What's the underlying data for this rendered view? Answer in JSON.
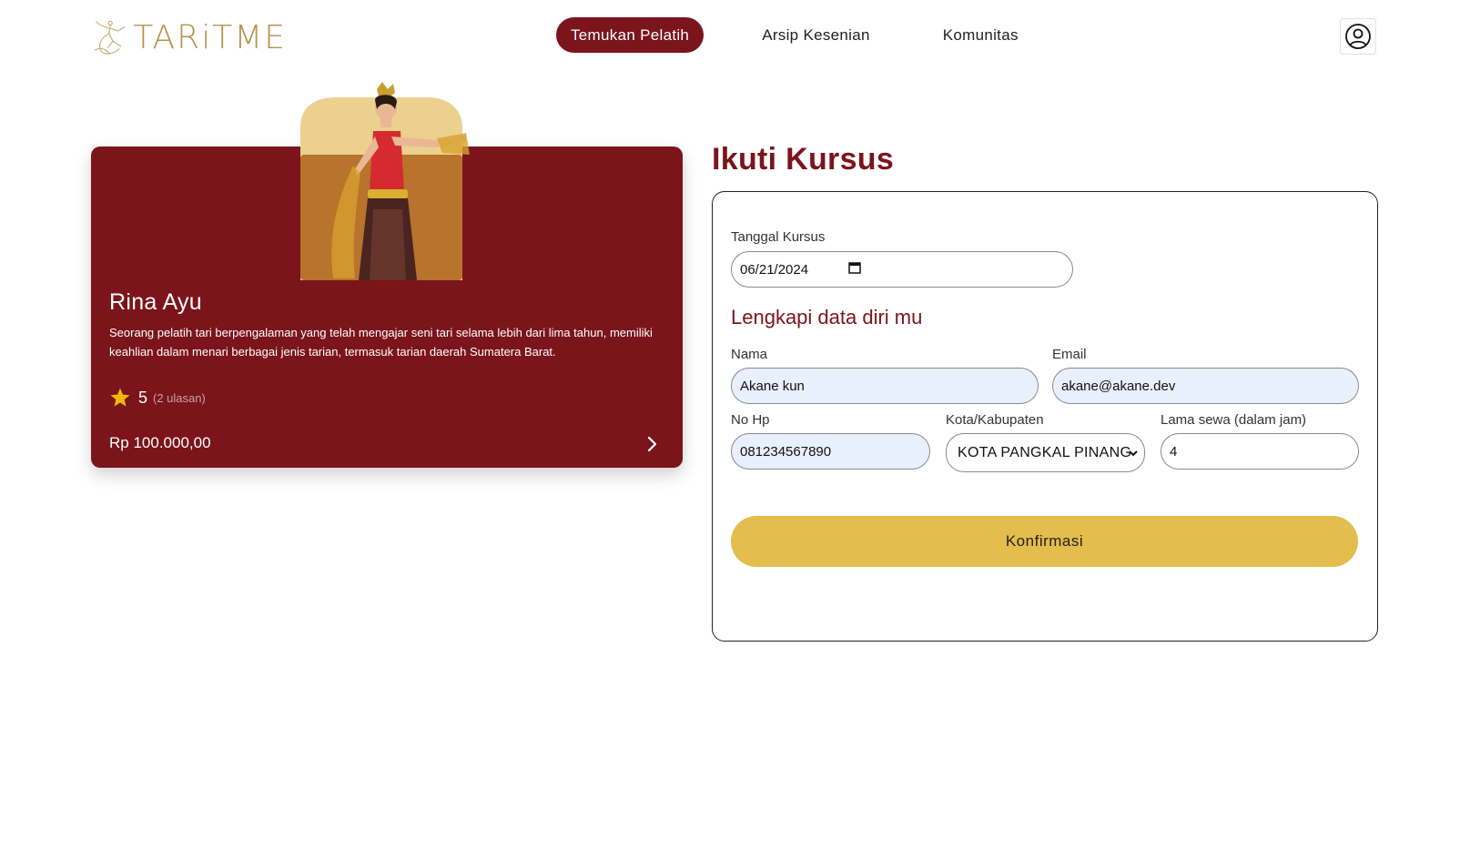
{
  "header": {
    "logo_text": "TARiTME",
    "nav": [
      {
        "label": "Temukan Pelatih",
        "active": true
      },
      {
        "label": "Arsip Kesenian",
        "active": false
      },
      {
        "label": "Komunitas",
        "active": false
      }
    ],
    "profile_icon": "user-circle-icon"
  },
  "trainer": {
    "name": "Rina Ayu",
    "description": "Seorang pelatih tari berpengalaman yang telah mengajar seni tari selama lebih dari lima tahun, memiliki keahlian dalam menari berbagai jenis tarian, termasuk tarian daerah Sumatera Barat.",
    "rating": "5",
    "reviews": "(2 ulasan)",
    "price": "Rp 100.000,00",
    "star_color": "#f2b705"
  },
  "form": {
    "title": "Ikuti Kursus",
    "date_label": "Tanggal Kursus",
    "date_value": "06/21/2024",
    "section_title": "Lengkapi data diri mu",
    "name_label": "Nama",
    "name_value": "Akane kun",
    "email_label": "Email",
    "email_value": "akane@akane.dev",
    "phone_label": "No Hp",
    "phone_value": "081234567890",
    "city_label": "Kota/Kabupaten",
    "city_value": "KOTA PANGKAL PINANG",
    "duration_label": "Lama sewa (dalam jam)",
    "duration_value": "4",
    "confirm_label": "Konfirmasi"
  },
  "colors": {
    "primary": "#7b141b",
    "accent": "#e3bd4d",
    "input_fill": "#e8f0fe"
  }
}
